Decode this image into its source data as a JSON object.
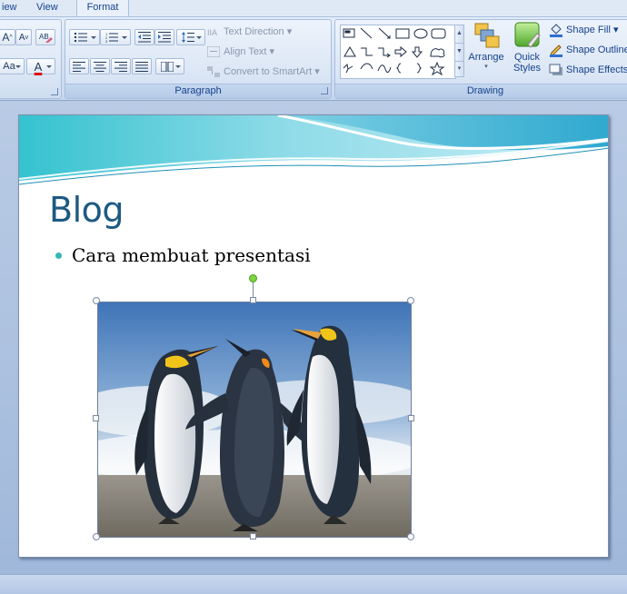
{
  "tabs": [
    {
      "label": "iew"
    },
    {
      "label": "View"
    },
    {
      "label": "Format"
    }
  ],
  "paragraph_group": {
    "label": "Paragraph",
    "text_direction": "Text Direction",
    "align_text": "Align Text",
    "convert_smartart": "Convert to SmartArt"
  },
  "drawing_group": {
    "label": "Drawing",
    "arrange": "Arrange",
    "quick_styles_line1": "Quick",
    "quick_styles_line2": "Styles",
    "shape_fill": "Shape Fill",
    "shape_outline": "Shape Outline",
    "shape_effects": "Shape Effects"
  },
  "font_group": {
    "grow_font": "A",
    "shrink_font": "A",
    "change_case": "Aa",
    "font_color": "A"
  },
  "slide": {
    "title": "Blog",
    "bullets": [
      "Cara membuat presentasi"
    ]
  },
  "picture": {
    "subject": "penguins"
  },
  "colors": {
    "title": "#1d5a82",
    "bullet": "#34b7b0",
    "ribbon_text": "#15428b",
    "wave": "#58c6dc"
  }
}
